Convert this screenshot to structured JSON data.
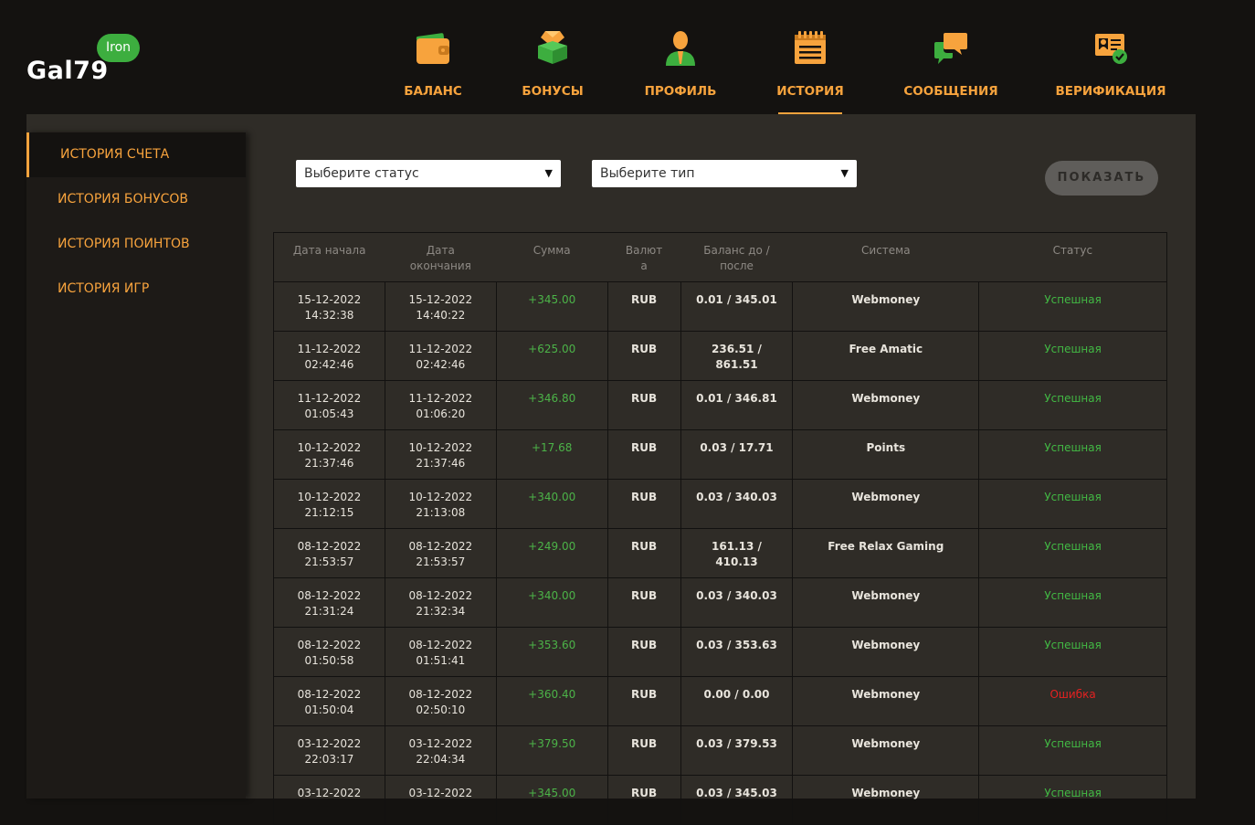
{
  "user": {
    "name": "Gal79",
    "rank": "Iron"
  },
  "nav": [
    {
      "label": "БАЛАНС",
      "icon": "wallet-icon",
      "active": false
    },
    {
      "label": "БОНУСЫ",
      "icon": "gift-box-icon",
      "active": false
    },
    {
      "label": "ПРОФИЛЬ",
      "icon": "user-icon",
      "active": false
    },
    {
      "label": "ИСТОРИЯ",
      "icon": "notepad-icon",
      "active": true
    },
    {
      "label": "СООБЩЕНИЯ",
      "icon": "chat-icon",
      "active": false
    },
    {
      "label": "ВЕРИФИКАЦИЯ",
      "icon": "id-card-check-icon",
      "active": false
    }
  ],
  "sidebar": [
    {
      "label": "ИСТОРИЯ СЧЕТА",
      "active": true
    },
    {
      "label": "ИСТОРИЯ БОНУСОВ",
      "active": false
    },
    {
      "label": "ИСТОРИЯ ПОИНТОВ",
      "active": false
    },
    {
      "label": "ИСТОРИЯ ИГР",
      "active": false
    }
  ],
  "filters": {
    "status_placeholder": "Выберите статус",
    "type_placeholder": "Выберите тип",
    "show_label": "ПОКАЗАТЬ"
  },
  "table": {
    "headers": [
      "Дата начала",
      "Дата окончания",
      "Сумма",
      "Валюта",
      "Баланс до / после",
      "Система",
      "Статус"
    ],
    "header_lines": [
      [
        "Дата начала"
      ],
      [
        "Дата",
        "окончания"
      ],
      [
        "Сумма"
      ],
      [
        "Валют",
        "а"
      ],
      [
        "Баланс до /",
        "после"
      ],
      [
        "Система"
      ],
      [
        "Статус"
      ]
    ],
    "rows": [
      {
        "start": [
          "15-12-2022",
          "14:32:38"
        ],
        "end": [
          "15-12-2022",
          "14:40:22"
        ],
        "sum": "+345.00",
        "cur": "RUB",
        "bal": [
          "0.01 / 345.01"
        ],
        "sys": "Webmoney",
        "status": "Успешная",
        "ok": true
      },
      {
        "start": [
          "11-12-2022",
          "02:42:46"
        ],
        "end": [
          "11-12-2022",
          "02:42:46"
        ],
        "sum": "+625.00",
        "cur": "RUB",
        "bal": [
          "236.51 /",
          "861.51"
        ],
        "sys": "Free Amatic",
        "status": "Успешная",
        "ok": true
      },
      {
        "start": [
          "11-12-2022",
          "01:05:43"
        ],
        "end": [
          "11-12-2022",
          "01:06:20"
        ],
        "sum": "+346.80",
        "cur": "RUB",
        "bal": [
          "0.01 / 346.81"
        ],
        "sys": "Webmoney",
        "status": "Успешная",
        "ok": true
      },
      {
        "start": [
          "10-12-2022",
          "21:37:46"
        ],
        "end": [
          "10-12-2022",
          "21:37:46"
        ],
        "sum": "+17.68",
        "cur": "RUB",
        "bal": [
          "0.03 / 17.71"
        ],
        "sys": "Points",
        "status": "Успешная",
        "ok": true
      },
      {
        "start": [
          "10-12-2022",
          "21:12:15"
        ],
        "end": [
          "10-12-2022",
          "21:13:08"
        ],
        "sum": "+340.00",
        "cur": "RUB",
        "bal": [
          "0.03 / 340.03"
        ],
        "sys": "Webmoney",
        "status": "Успешная",
        "ok": true
      },
      {
        "start": [
          "08-12-2022",
          "21:53:57"
        ],
        "end": [
          "08-12-2022",
          "21:53:57"
        ],
        "sum": "+249.00",
        "cur": "RUB",
        "bal": [
          "161.13 /",
          "410.13"
        ],
        "sys": "Free Relax Gaming",
        "status": "Успешная",
        "ok": true
      },
      {
        "start": [
          "08-12-2022",
          "21:31:24"
        ],
        "end": [
          "08-12-2022",
          "21:32:34"
        ],
        "sum": "+340.00",
        "cur": "RUB",
        "bal": [
          "0.03 / 340.03"
        ],
        "sys": "Webmoney",
        "status": "Успешная",
        "ok": true
      },
      {
        "start": [
          "08-12-2022",
          "01:50:58"
        ],
        "end": [
          "08-12-2022",
          "01:51:41"
        ],
        "sum": "+353.60",
        "cur": "RUB",
        "bal": [
          "0.03 / 353.63"
        ],
        "sys": "Webmoney",
        "status": "Успешная",
        "ok": true
      },
      {
        "start": [
          "08-12-2022",
          "01:50:04"
        ],
        "end": [
          "08-12-2022",
          "02:50:10"
        ],
        "sum": "+360.40",
        "cur": "RUB",
        "bal": [
          "0.00 / 0.00"
        ],
        "sys": "Webmoney",
        "status": "Ошибка",
        "ok": false
      },
      {
        "start": [
          "03-12-2022",
          "22:03:17"
        ],
        "end": [
          "03-12-2022",
          "22:04:34"
        ],
        "sum": "+379.50",
        "cur": "RUB",
        "bal": [
          "0.03 / 379.53"
        ],
        "sys": "Webmoney",
        "status": "Успешная",
        "ok": true
      },
      {
        "start": [
          "03-12-2022",
          ""
        ],
        "end": [
          "03-12-2022",
          ""
        ],
        "sum": "+345.00",
        "cur": "RUB",
        "bal": [
          "0.03 / 345.03"
        ],
        "sys": "Webmoney",
        "status": "Успешная",
        "ok": true
      }
    ]
  },
  "colors": {
    "accent": "#f7a33d",
    "success": "#42b844",
    "error": "#e42121",
    "rank_badge": "#3dae3f"
  }
}
